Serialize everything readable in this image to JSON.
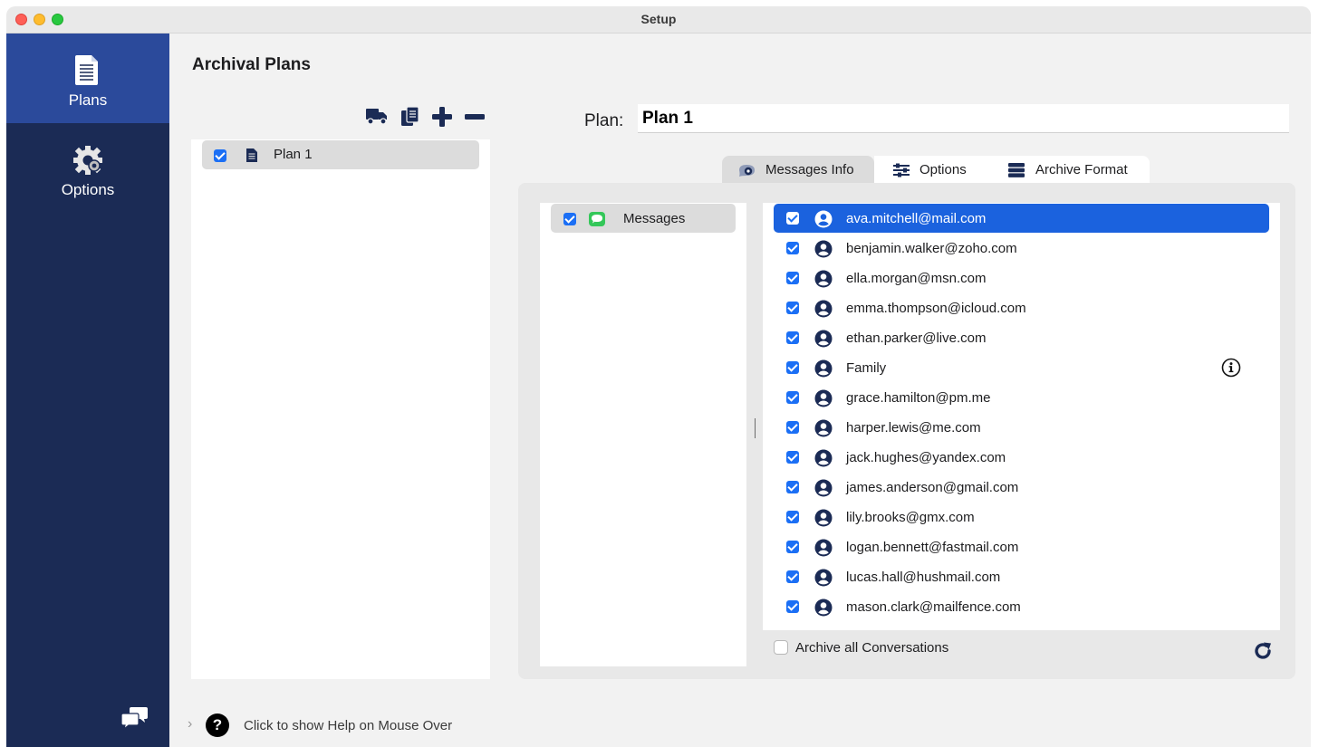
{
  "window": {
    "title": "Setup"
  },
  "sidebar": {
    "items": [
      {
        "label": "Plans",
        "icon": "document-icon",
        "active": true
      },
      {
        "label": "Options",
        "icon": "gear-icon",
        "active": false
      }
    ],
    "footer_icon": "chat-bubbles-icon"
  },
  "main": {
    "title": "Archival Plans",
    "toolbar": [
      "truck-icon",
      "duplicate-icon",
      "add-icon",
      "remove-icon"
    ],
    "plans": [
      {
        "name": "Plan 1",
        "checked": true
      }
    ],
    "plan_field": {
      "label": "Plan:",
      "value": "Plan 1"
    },
    "tabs": [
      {
        "label": "Messages Info",
        "icon": "messages-info-icon",
        "active": true
      },
      {
        "label": "Options",
        "icon": "sliders-icon",
        "active": false
      },
      {
        "label": "Archive Format",
        "icon": "archive-stack-icon",
        "active": false
      }
    ],
    "sources": [
      {
        "name": "Messages",
        "checked": true
      }
    ],
    "contacts": [
      {
        "name": "ava.mitchell@mail.com",
        "checked": true,
        "selected": true
      },
      {
        "name": "benjamin.walker@zoho.com",
        "checked": true
      },
      {
        "name": "ella.morgan@msn.com",
        "checked": true
      },
      {
        "name": "emma.thompson@icloud.com",
        "checked": true
      },
      {
        "name": "ethan.parker@live.com",
        "checked": true
      },
      {
        "name": "Family",
        "checked": true,
        "info": true
      },
      {
        "name": "grace.hamilton@pm.me",
        "checked": true
      },
      {
        "name": "harper.lewis@me.com",
        "checked": true
      },
      {
        "name": "jack.hughes@yandex.com",
        "checked": true
      },
      {
        "name": "james.anderson@gmail.com",
        "checked": true
      },
      {
        "name": "lily.brooks@gmx.com",
        "checked": true
      },
      {
        "name": "logan.bennett@fastmail.com",
        "checked": true
      },
      {
        "name": "lucas.hall@hushmail.com",
        "checked": true
      },
      {
        "name": "mason.clark@mailfence.com",
        "checked": true
      }
    ],
    "archive_all": {
      "label": "Archive all Conversations",
      "checked": false
    },
    "help": {
      "text": "Click to show Help on Mouse Over",
      "glyph": "?",
      "chevron": "›"
    }
  },
  "colors": {
    "sidebar": "#1b2b55",
    "sidebar_active": "#2b4a9b",
    "accent": "#1b6ff5",
    "selection": "#1b62de",
    "messages_green": "#34c759"
  }
}
